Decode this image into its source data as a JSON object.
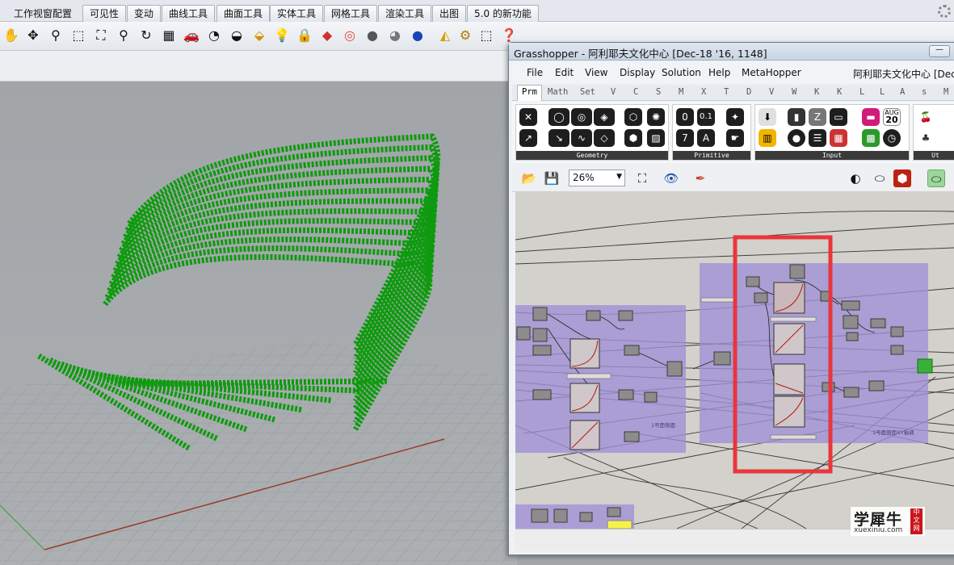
{
  "rhino": {
    "tabs": [
      "工作视窗配置",
      "可见性",
      "变动",
      "曲线工具",
      "曲面工具",
      "实体工具",
      "网格工具",
      "渲染工具",
      "出图",
      "5.0 的新功能"
    ],
    "toolbar_icons": [
      "pan-hand-icon",
      "move-view-icon",
      "zoom-dynamic-icon",
      "zoom-window-icon",
      "zoom-extents-icon",
      "zoom-selected-icon",
      "rotate-view-icon",
      "four-viewports-icon",
      "car-render-icon",
      "hide-objects-icon",
      "show-objects-icon",
      "layer-visibility-icon",
      "light-bulb-icon",
      "lock-icon",
      "material-icon",
      "color-wheel-icon",
      "shaded-sphere-icon",
      "rendered-sphere-icon",
      "blue-sphere-icon",
      "snap-point-icon",
      "settings-gear-icon",
      "selection-icon",
      "help-icon"
    ]
  },
  "gh": {
    "title": "Grasshopper - 阿利耶夫文化中心 [Dec-18 '16, 1148]",
    "min_label": "—",
    "menu": [
      "File",
      "Edit",
      "View",
      "Display",
      "Solution",
      "Help",
      "MetaHopper"
    ],
    "doc_name": "阿利耶夫文化中心 [Dec-",
    "tabs": [
      "Prm",
      "Math",
      "Set",
      "V",
      "C",
      "S",
      "M",
      "X",
      "T",
      "D",
      "V",
      "W",
      "K",
      "K",
      "L",
      "L",
      "A",
      "s",
      "M"
    ],
    "ribbon_groups": [
      "Geometry",
      "Primitive",
      "Input",
      "Ut"
    ],
    "primitive_labels": [
      "0",
      "0.1",
      "7",
      "A"
    ],
    "input_date_month": "AUG",
    "input_date_day": "20",
    "zoom": "26%",
    "group_label_left": "1号面侧面",
    "group_label_right": "1号面侧面XY轴调",
    "colors": {
      "group_purple": "#a08fd6",
      "highlight_red": "#e8363c",
      "canvas": "#d3d1cb",
      "geometry_green": "#0f9a0f"
    }
  },
  "watermark": {
    "text": "学犀牛",
    "url": "xuexiniu.com",
    "seal": "中文网"
  }
}
